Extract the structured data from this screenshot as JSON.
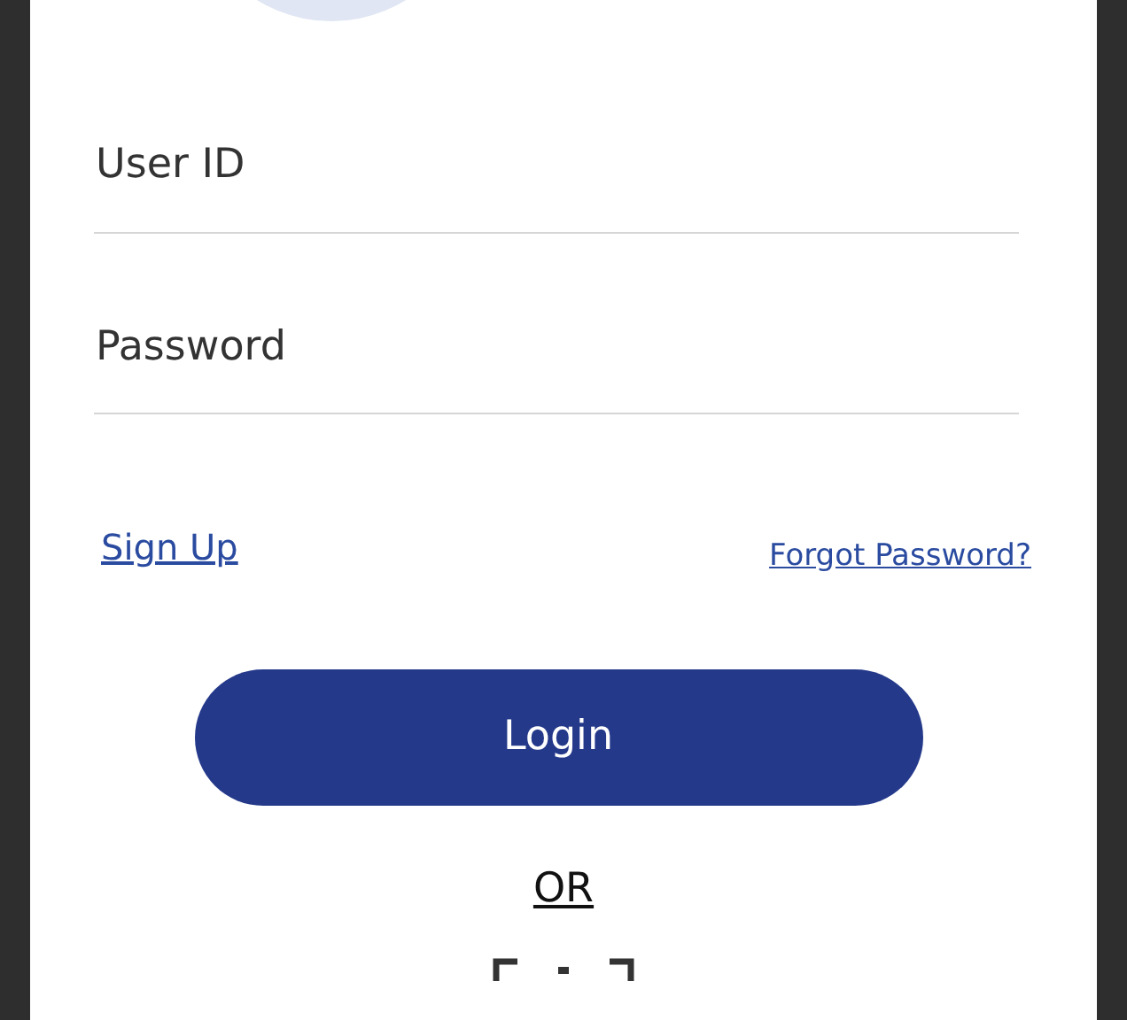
{
  "fields": [
    {
      "placeholder": "User ID"
    },
    {
      "placeholder": "Password"
    }
  ],
  "links": {
    "sign_up": "Sign Up",
    "forgot_password": "Forgot Password?"
  },
  "login_button": "Login",
  "separator": "OR"
}
